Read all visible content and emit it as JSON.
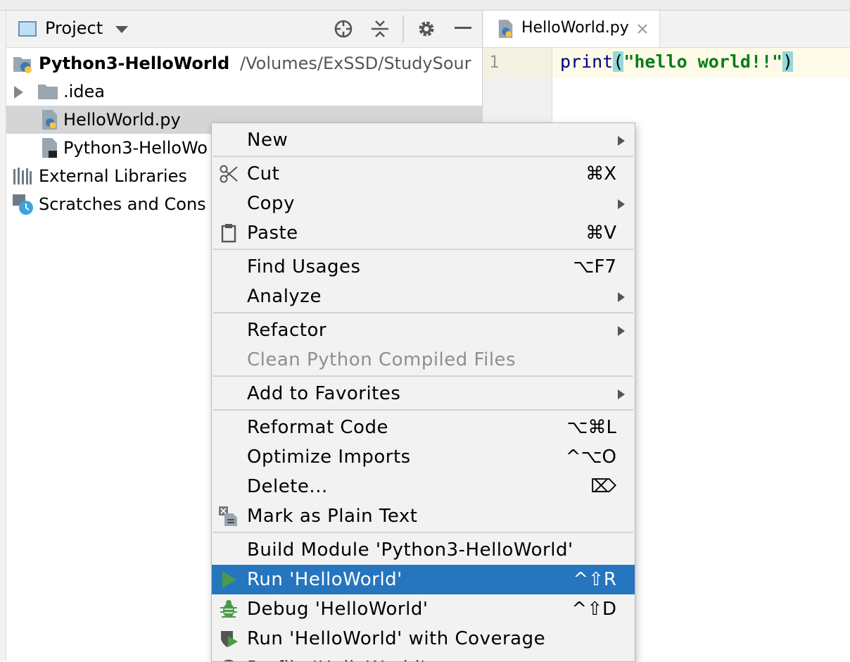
{
  "project_panel": {
    "title": "Project",
    "tree": {
      "root": {
        "name": "Python3-HelloWorld",
        "path": "/Volumes/ExSSD/StudySour"
      },
      "idea_folder": ".idea",
      "file_py": "HelloWorld.py",
      "file_other": "Python3-HelloWo",
      "external_libraries": "External Libraries",
      "scratches": "Scratches and Cons"
    }
  },
  "editor": {
    "tab_label": "HelloWorld.py",
    "line_number": "1",
    "code": {
      "func": "print",
      "open_paren": "(",
      "string": "\"hello world!!\"",
      "close_paren": ")"
    }
  },
  "context_menu": {
    "new": "New",
    "cut": "Cut",
    "cut_sc": "⌘X",
    "copy": "Copy",
    "paste": "Paste",
    "paste_sc": "⌘V",
    "find_usages": "Find Usages",
    "find_usages_sc": "⌥F7",
    "analyze": "Analyze",
    "refactor": "Refactor",
    "clean_python": "Clean Python Compiled Files",
    "add_favorites": "Add to Favorites",
    "reformat": "Reformat Code",
    "reformat_sc": "⌥⌘L",
    "optimize": "Optimize Imports",
    "optimize_sc": "^⌥O",
    "delete": "Delete...",
    "delete_sc": "⌦",
    "mark_plain": "Mark as Plain Text",
    "build_module": "Build Module 'Python3-HelloWorld'",
    "run": "Run 'HelloWorld'",
    "run_sc": "^⇧R",
    "debug": "Debug 'HelloWorld'",
    "debug_sc": "^⇧D",
    "run_coverage": "Run 'HelloWorld' with Coverage",
    "profile_partial": "Profile 'HelloWorld'"
  },
  "colors": {
    "highlight": "#2675bf",
    "string": "#067d17",
    "keyword": "#000080",
    "paren_match": "#93d9d9",
    "run_green": "#4a9a4a"
  }
}
